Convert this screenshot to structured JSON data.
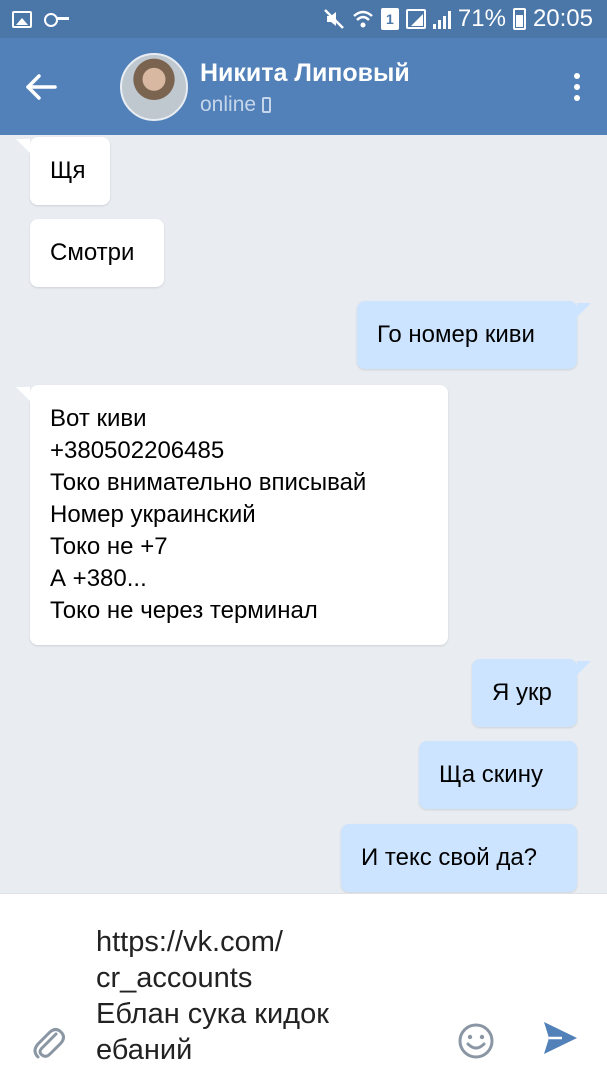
{
  "status_bar": {
    "battery_percent": "71%",
    "time": "20:05",
    "sim_slot": "1",
    "icons": [
      "gallery-icon",
      "key-icon",
      "mute-icon",
      "wifi-icon",
      "sim-icon",
      "signal-icon",
      "battery-icon"
    ]
  },
  "header": {
    "contact_name": "Никита Липовый",
    "status": "online",
    "icons": [
      "back-arrow-icon",
      "avatar",
      "phone-icon",
      "more-vert-icon"
    ]
  },
  "messages": [
    {
      "direction": "in",
      "text": "Щя"
    },
    {
      "direction": "in",
      "text": "Смотри"
    },
    {
      "direction": "out",
      "text": "Го номер киви"
    },
    {
      "direction": "in",
      "lines": [
        "Вот киви",
        "+380502206485",
        "Токо внимательно вписывай",
        "Номер украинский",
        "Токо не +7",
        "А +380...",
        "Токо не через терминал"
      ]
    },
    {
      "direction": "out",
      "text": "Я укр"
    },
    {
      "direction": "out",
      "text": "Ща скину"
    },
    {
      "direction": "out",
      "text": "И текс свой да?"
    }
  ],
  "composer": {
    "value": "https://vk.com/\ncr_accounts\nЕблан сука кидок\nебаний",
    "icons": [
      "attach-icon",
      "emoji-icon",
      "send-icon"
    ]
  },
  "colors": {
    "status_bar": "#4a76a8",
    "header": "#5181b8",
    "chat_bg": "#e9edf2",
    "incoming_bubble": "#ffffff",
    "outgoing_bubble": "#cce4ff",
    "accent": "#5181b8"
  }
}
